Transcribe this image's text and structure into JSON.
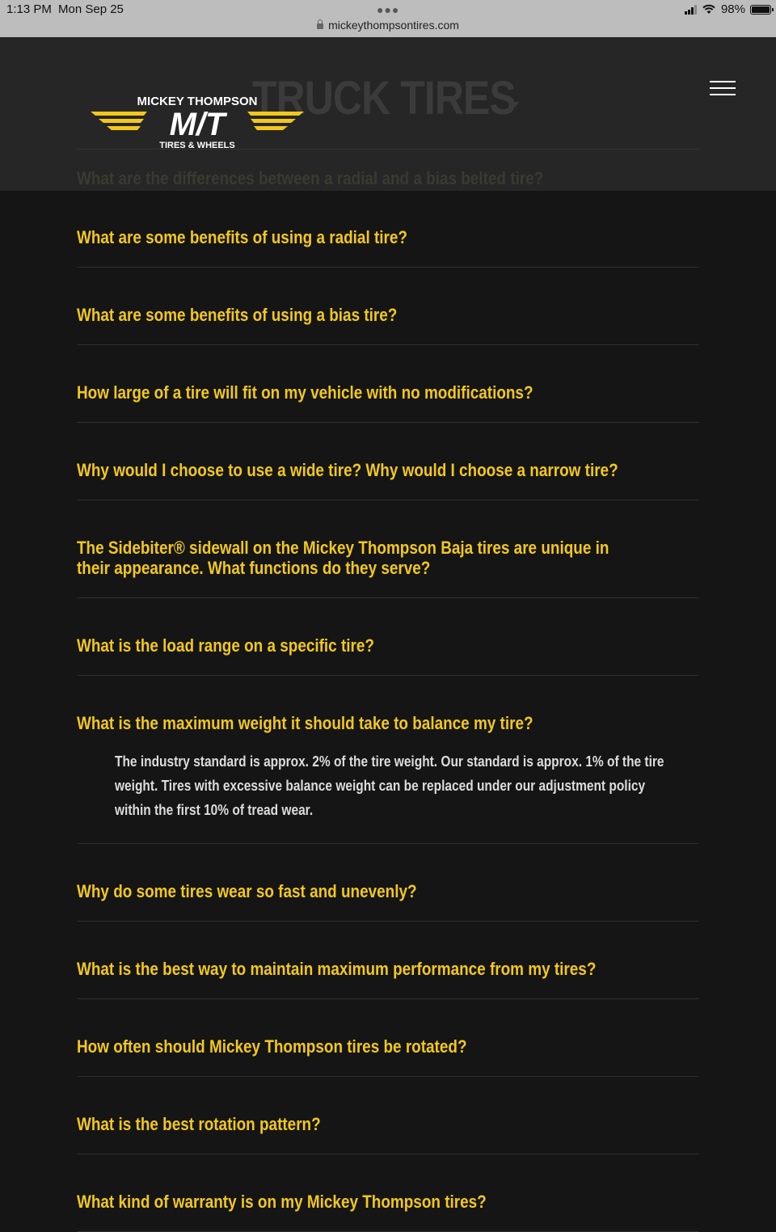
{
  "status_bar": {
    "time": "1:13 PM",
    "date": "Mon Sep 25",
    "url": "mickeythompsontires.com",
    "battery": "98%"
  },
  "header": {
    "logo": {
      "top_text": "MICKEY THOMPSON",
      "mark": "M/T",
      "bottom_text": "TIRES & WHEELS"
    },
    "section_title": "TRUCK TIRES",
    "menu_icon": "hamburger-icon",
    "first_question": "What are the differences between a radial and a bias belted tire?"
  },
  "colors": {
    "accent": "#f2c81c",
    "background": "#151515",
    "header": "#262626"
  },
  "faq": [
    {
      "question": "What are some benefits of using a radial tire?"
    },
    {
      "question": "What are some benefits of using a bias tire?"
    },
    {
      "question": "How large of a tire will fit on my vehicle with no modifications?"
    },
    {
      "question": "Why would I choose to use a wide tire? Why would I choose a narrow tire?"
    },
    {
      "question": "The Sidebiter® sidewall on the Mickey Thompson Baja tires are unique in their appearance. What functions do they serve?"
    },
    {
      "question": "What is the load range on a specific tire?"
    },
    {
      "question": "What is the maximum weight it should take to balance my tire?",
      "answer": "The industry standard is approx. 2% of the tire weight. Our standard is approx. 1% of the tire weight. Tires with excessive balance weight can be replaced under our adjustment policy within the first 10% of tread wear."
    },
    {
      "question": "Why do some tires wear so fast and unevenly?"
    },
    {
      "question": "What is the best way to maintain maximum performance from my tires?"
    },
    {
      "question": "How often should Mickey Thompson tires be rotated?"
    },
    {
      "question": "What is the best rotation pattern?"
    },
    {
      "question": "What kind of warranty is on my Mickey Thompson tires?"
    }
  ]
}
